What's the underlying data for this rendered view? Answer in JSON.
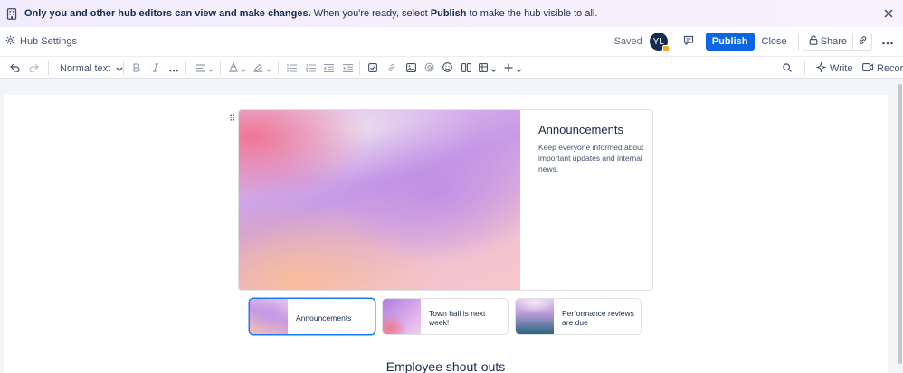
{
  "banner": {
    "bold_text": "Only you and other hub editors can view and make changes.",
    "text_before": " When you're ready, select ",
    "publish_word": "Publish",
    "text_after": " to make the hub visible to all."
  },
  "header": {
    "hub_settings": "Hub Settings",
    "saved": "Saved",
    "avatar_initials": "YL",
    "publish": "Publish",
    "close": "Close",
    "share": "Share"
  },
  "toolbar": {
    "text_style": "Normal text",
    "write": "Write",
    "record": "Record"
  },
  "hero": {
    "title": "Announcements",
    "description": "Keep everyone informed about important updates and internal news."
  },
  "cards": [
    {
      "label": "Announcements"
    },
    {
      "label": "Town hall is next week!"
    },
    {
      "label": "Performance reviews are due"
    }
  ],
  "next_section": {
    "title": "Employee shout-outs"
  },
  "colors": {
    "primary": "#0c66e4",
    "selected_border": "#1d7afc",
    "text": "#172b4d",
    "banner_bg": "#f3eefb"
  }
}
